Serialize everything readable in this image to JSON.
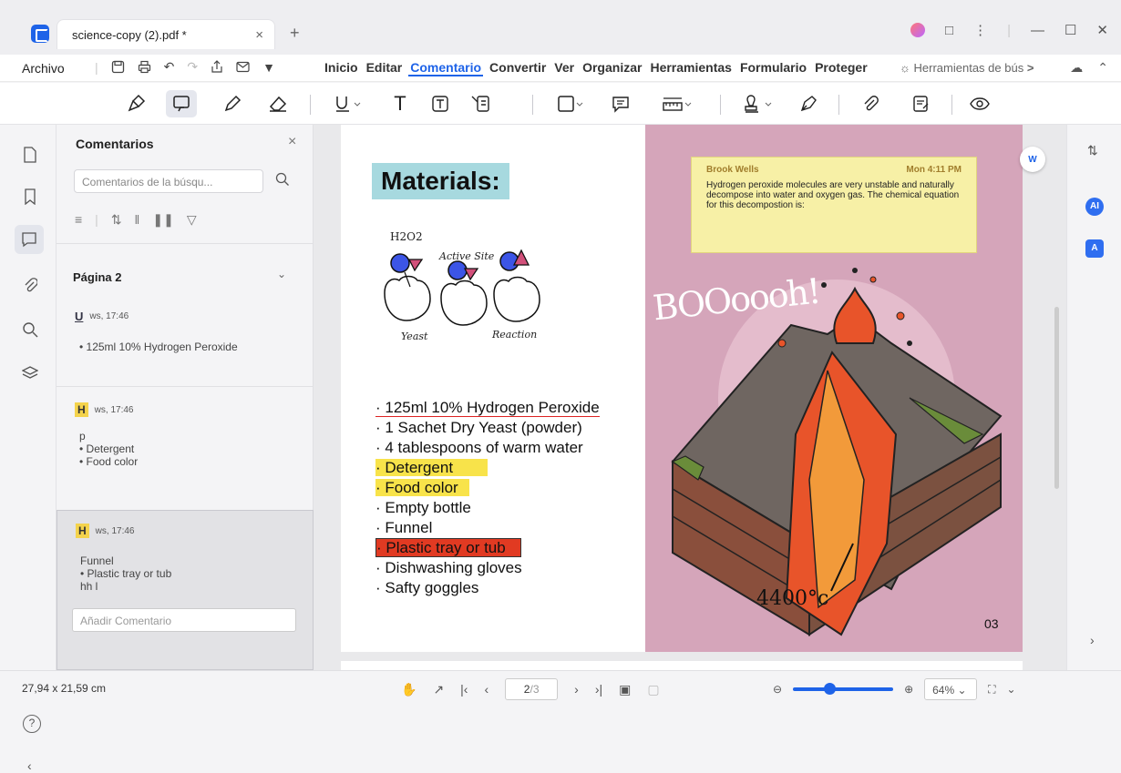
{
  "tab": {
    "title": "science-copy (2).pdf *"
  },
  "menubar": {
    "archivo": "Archivo",
    "menus": [
      "Inicio",
      "Editar",
      "Comentario",
      "Convertir",
      "Ver",
      "Organizar",
      "Herramientas",
      "Formulario",
      "Proteger"
    ],
    "active_menu": "Comentario",
    "tools_search": "Herramientas de bús",
    "more": ">"
  },
  "comments_panel": {
    "title": "Comentarios",
    "search_placeholder": "Comentarios de la búsqu...",
    "page_label": "Página 2",
    "cards": [
      {
        "type": "U",
        "time": "ws, 17:46",
        "body": "• 125ml 10% Hydrogen Peroxide"
      },
      {
        "type": "H",
        "time": "ws, 17:46",
        "body": "p\n• Detergent\n• Food color"
      },
      {
        "type": "H",
        "time": "ws, 17:46",
        "body": "Funnel\n• Plastic tray or tub\nhh l"
      }
    ],
    "add_comment_placeholder": "Añadir Comentario"
  },
  "document": {
    "materials_title": "Materials:",
    "diagram_labels": {
      "h2o2": "H2O2",
      "active_site": "Active Site",
      "yeast": "Yeast",
      "reaction": "Reaction"
    },
    "materials": [
      "· 125ml 10% Hydrogen Peroxide",
      "· 1 Sachet Dry Yeast (powder)",
      "· 4 tablespoons of warm water",
      "· Detergent",
      "· Food color",
      "· Empty bottle",
      "· Funnel",
      "· Plastic tray or tub",
      "· Dishwashing gloves",
      "· Safty goggles"
    ],
    "sticky": {
      "author": "Brook Wells",
      "time": "Mon 4:11 PM",
      "text": "Hydrogen peroxide molecules are very unstable and naturally decompose into water and oxygen gas. The chemical equation for this decompostion is:"
    },
    "boom": "BOOoooh!",
    "temperature": "4400°c",
    "page_number": "03"
  },
  "status": {
    "dimensions": "27,94 x 21,59 cm",
    "page_current": "2",
    "page_total": "/3",
    "zoom": "64%",
    "zoom_level": 0.31
  },
  "colors": {
    "accent": "#1e63e8",
    "highlight_yellow": "#f8e34a",
    "highlight_red": "#e13a22",
    "page_pink": "#d5a5ba"
  },
  "right_rail": {
    "ai_label": "AI",
    "translate_label": "A"
  }
}
